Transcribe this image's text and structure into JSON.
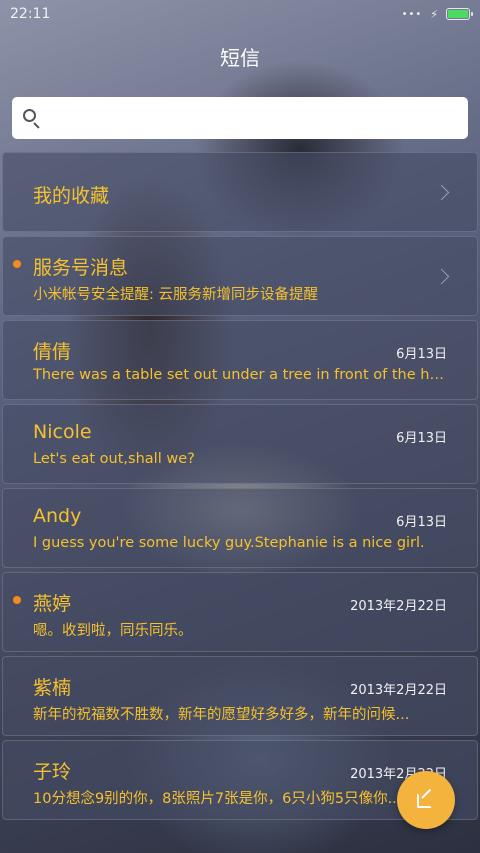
{
  "status": {
    "time": "22:11",
    "signal": "•••",
    "charging": "⚡",
    "battery_level": 1.0
  },
  "header": {
    "title": "短信"
  },
  "search": {
    "placeholder": ""
  },
  "favorites": {
    "label": "我的收藏"
  },
  "service": {
    "name": "服务号消息",
    "preview": "小米帐号安全提醒: 云服务新增同步设备提醒",
    "unread": true
  },
  "conversations": [
    {
      "name": "倩倩",
      "preview": "There was a table set out under a tree in front of the ho...",
      "date": "6月13日",
      "unread": false
    },
    {
      "name": "Nicole",
      "preview": "Let's eat out,shall we?",
      "date": "6月13日",
      "unread": false
    },
    {
      "name": "Andy",
      "preview": "I guess you're some lucky guy.Stephanie is a nice girl.",
      "date": "6月13日",
      "unread": false
    },
    {
      "name": "燕婷",
      "preview": "嗯。收到啦，同乐同乐。",
      "date": "2013年2月22日",
      "unread": true
    },
    {
      "name": "紫楠",
      "preview": "新年的祝福数不胜数，新年的愿望好多好多，新年的问候...",
      "date": "2013年2月22日",
      "unread": false
    },
    {
      "name": "子玲",
      "preview": "10分想念9别的你，8张照片7张是你，6只小狗5只像你...",
      "date": "2013年2月22日",
      "unread": false
    }
  ],
  "colors": {
    "accent": "#f5c12e",
    "unread_dot": "#f58a1f",
    "fab": "#f3b33d"
  },
  "icons": {
    "search": "search-icon",
    "compose": "compose-icon",
    "chevron": "chevron-right-icon"
  }
}
